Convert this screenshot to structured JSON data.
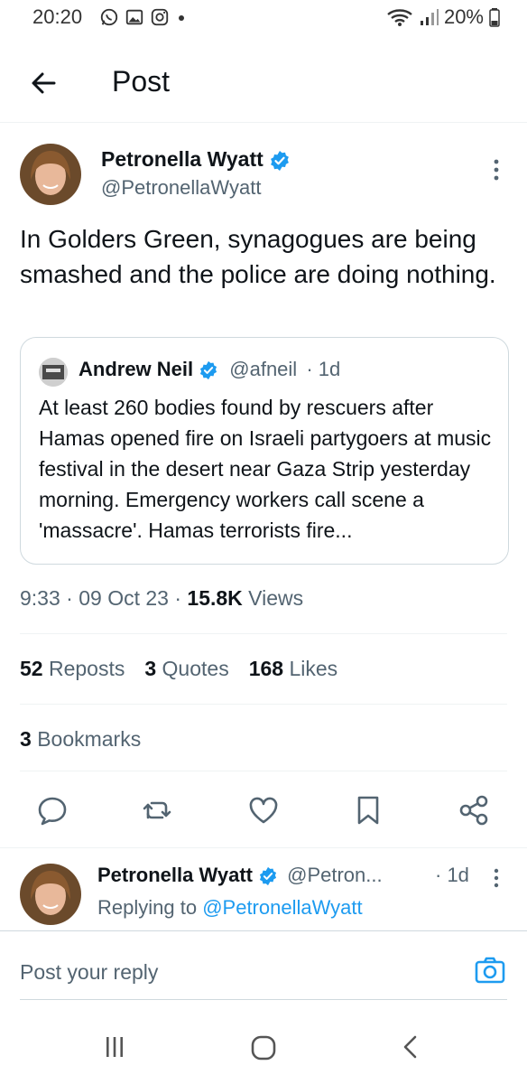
{
  "status_bar": {
    "time": "20:20",
    "battery": "20%"
  },
  "header": {
    "title": "Post"
  },
  "post": {
    "author_name": "Petronella Wyatt",
    "author_handle": "@PetronellaWyatt",
    "text": "In Golders Green, synagogues are being smashed and the police are doing nothing.",
    "quote": {
      "name": "Andrew Neil",
      "handle": "@afneil",
      "time": "· 1d",
      "text": "At least 260 bodies found by rescuers after Hamas opened fire on Israeli partygoers at music festival in the desert near Gaza Strip yesterday morning. Emergency workers call scene a 'massacre'.  Hamas terrorists fire..."
    },
    "meta": {
      "time": "9:33",
      "date": "09 Oct 23",
      "views_count": "15.8K",
      "views_label": "Views"
    },
    "stats": {
      "reposts_count": "52",
      "reposts_label": "Reposts",
      "quotes_count": "3",
      "quotes_label": "Quotes",
      "likes_count": "168",
      "likes_label": "Likes",
      "bookmarks_count": "3",
      "bookmarks_label": "Bookmarks"
    }
  },
  "reply": {
    "name": "Petronella Wyatt",
    "handle": "@Petron...",
    "time": "· 1d",
    "replying_prefix": "Replying to",
    "replying_handle": "@PetronellaWyatt"
  },
  "compose": {
    "placeholder": "Post your reply"
  },
  "colors": {
    "accent": "#1d9bf0",
    "text": "#0f1419",
    "muted": "#536471",
    "border": "#cfd9de"
  },
  "icons": [
    "whatsapp-icon",
    "gallery-icon",
    "instagram-icon",
    "wifi-icon",
    "signal-icon",
    "battery-icon",
    "back-arrow-icon",
    "verified-icon",
    "kebab-icon",
    "reply-icon",
    "repost-icon",
    "like-icon",
    "bookmark-icon",
    "share-icon",
    "camera-icon",
    "recents-icon",
    "home-icon",
    "nav-back-icon"
  ]
}
